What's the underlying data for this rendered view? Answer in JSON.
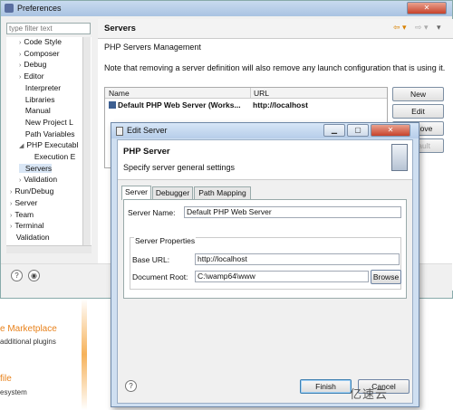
{
  "background": {
    "marketplace_title": "e Marketplace",
    "marketplace_sub": "additional plugins",
    "profile_title": "file",
    "profile_sub": "esystem"
  },
  "prefs": {
    "title": "Preferences",
    "filter_placeholder": "type filter text",
    "tree": [
      {
        "label": "Code Style",
        "indent": 1,
        "arrow": "›"
      },
      {
        "label": "Composer",
        "indent": 1,
        "arrow": "›"
      },
      {
        "label": "Debug",
        "indent": 1,
        "arrow": "›"
      },
      {
        "label": "Editor",
        "indent": 1,
        "arrow": "›"
      },
      {
        "label": "Interpreter",
        "indent": 1,
        "arrow": ""
      },
      {
        "label": "Libraries",
        "indent": 1,
        "arrow": ""
      },
      {
        "label": "Manual",
        "indent": 1,
        "arrow": ""
      },
      {
        "label": "New Project L",
        "indent": 1,
        "arrow": ""
      },
      {
        "label": "Path Variables",
        "indent": 1,
        "arrow": ""
      },
      {
        "label": "PHP Executabl",
        "indent": 1,
        "arrow": "◢"
      },
      {
        "label": "Execution E",
        "indent": 2,
        "arrow": ""
      },
      {
        "label": "Servers",
        "indent": 1,
        "arrow": "",
        "selected": true
      },
      {
        "label": "Validation",
        "indent": 1,
        "arrow": "›"
      },
      {
        "label": "Run/Debug",
        "indent": 0,
        "arrow": "›"
      },
      {
        "label": "Server",
        "indent": 0,
        "arrow": "›"
      },
      {
        "label": "Team",
        "indent": 0,
        "arrow": "›"
      },
      {
        "label": "Terminal",
        "indent": 0,
        "arrow": "›"
      },
      {
        "label": "Validation",
        "indent": 0,
        "arrow": ""
      }
    ],
    "page_title": "Servers",
    "description": "PHP Servers Management",
    "note": "Note that removing a server definition will also remove any launch configuration that is using it.",
    "table": {
      "headers": [
        "Name",
        "URL"
      ],
      "rows": [
        [
          "Default PHP Web Server (Works...",
          "http://localhost"
        ]
      ]
    },
    "buttons": {
      "new": "New",
      "edit": "Edit",
      "remove": "Remove",
      "default": "Default"
    }
  },
  "dialog": {
    "title": "Edit Server",
    "header": "PHP Server",
    "subheader": "Specify server general settings",
    "tabs": [
      "Server",
      "Debugger",
      "Path Mapping"
    ],
    "active_tab": "Server",
    "server_name_label": "Server Name:",
    "server_name_value": "Default PHP Web Server",
    "group_title": "Server Properties",
    "base_url_label": "Base URL:",
    "base_url_value": "http://localhost",
    "doc_root_label": "Document Root:",
    "doc_root_value": "C:\\wamp64\\www",
    "browse_label": "Browse",
    "finish_label": "Finish",
    "cancel_label": "Cancel"
  },
  "watermark": "亿速云"
}
